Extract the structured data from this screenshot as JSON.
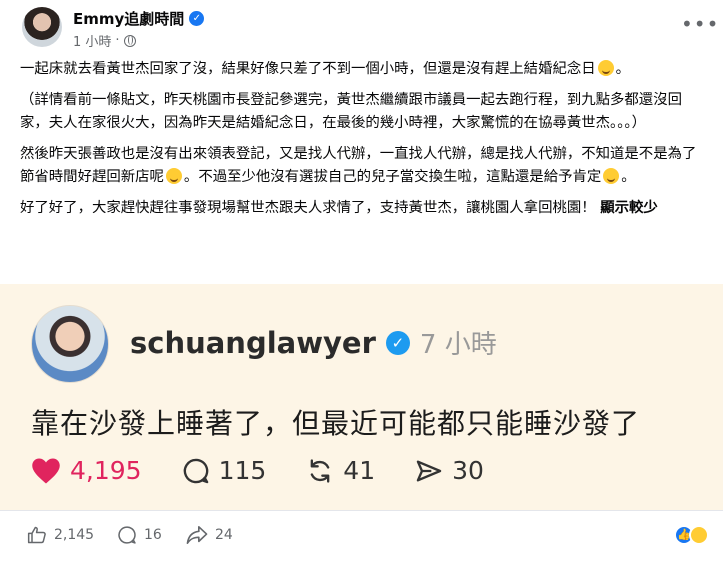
{
  "post": {
    "author": "Emmy追劇時間",
    "time": "1 小時",
    "paragraphs": [
      "一起床就去看黃世杰回家了沒，結果好像只差了不到一個小時，但還是沒有趕上結婚紀念日",
      "（詳情看前一條貼文，昨天桃園市長登記參選完，黃世杰繼續跟市議員一起去跑行程，到九點多都還沒回家，夫人在家很火大，因為昨天是結婚紀念日，在最後的幾小時裡，大家驚慌的在協尋黃世杰。。。）",
      "然後昨天張善政也是沒有出來領表登記，又是找人代辦，一直找人代辦，總是找人代辦，不知道是不是為了節省時間好趕回新店呢",
      "。不過至少他沒有選拔自己的兒子當交換生啦，這點還是給予肯定",
      "好了好了，大家趕快趕往事發現場幫世杰跟夫人求情了，支持黃世杰，讓桃園人拿回桃園！"
    ],
    "p1_end": "。",
    "p4_end": "。",
    "see_more": "顯示較少",
    "icons": {
      "verified": "verified-badge-icon",
      "privacy": "globe-icon",
      "more": "more-dots-icon",
      "emoji": "grinning-emoji-icon"
    }
  },
  "embed": {
    "handle": "schuanglawyer",
    "time": "7 小時",
    "text": "靠在沙發上睡著了，但最近可能都只能睡沙發了",
    "likes": "4,195",
    "replies": "115",
    "reposts": "41",
    "shares": "30",
    "colors": {
      "heart": "#e0245e",
      "background": "#fdf5e6"
    }
  },
  "footer": {
    "like_count": "2,145",
    "comment_count": "16",
    "share_count": "24",
    "reactions": [
      "like-reaction-icon",
      "haha-reaction-icon"
    ]
  }
}
